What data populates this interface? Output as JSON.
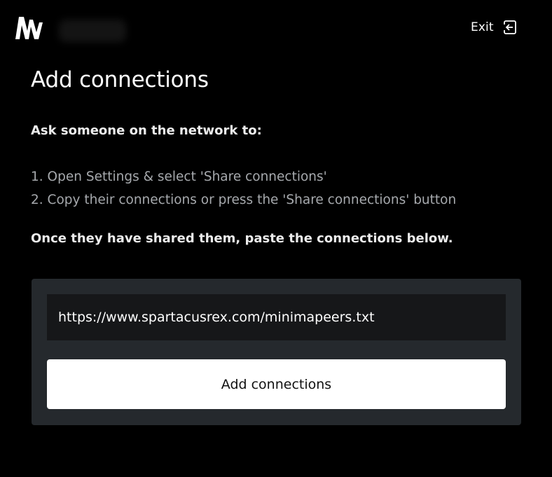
{
  "header": {
    "logo_icon": "brand-logo-icon",
    "exit_label": "Exit",
    "exit_icon": "exit-icon"
  },
  "main": {
    "title": "Add connections",
    "ask_text": "Ask someone on the network to:",
    "steps": [
      "1. Open Settings & select 'Share connections'",
      "2. Copy their connections or press the 'Share connections' button"
    ],
    "once_text": "Once they have shared them, paste the connections below."
  },
  "form": {
    "url_value": "https://www.spartacusrex.com/minimapeers.txt",
    "submit_label": "Add connections"
  },
  "colors": {
    "background": "#000000",
    "panel": "#25292d",
    "input": "#161719",
    "button": "#ffffff",
    "muted_text": "#a6a9ad"
  }
}
